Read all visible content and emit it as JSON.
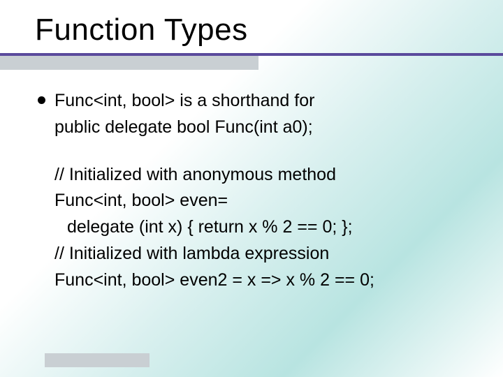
{
  "title": "Function Types",
  "bullet": {
    "line1": "Func<int, bool> is a shorthand for",
    "line2": "public delegate bool Func(int a0);"
  },
  "code": {
    "c1": "// Initialized with anonymous method",
    "c2": "Func<int, bool> even=",
    "c3": "delegate (int x) { return x % 2 == 0; };",
    "c4": "// Initialized with lambda expression",
    "c5": "Func<int, bool> even2 = x => x % 2 == 0;"
  }
}
